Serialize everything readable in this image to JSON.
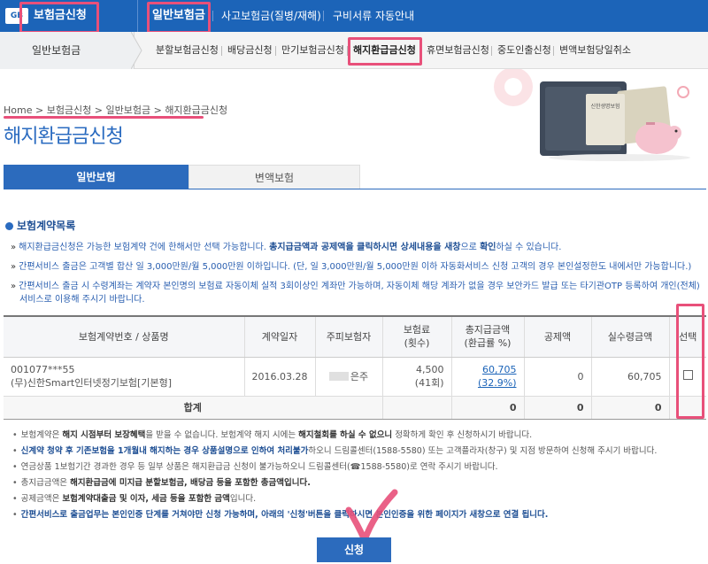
{
  "topbar": {
    "logo_icon": "insurance-logo-icon",
    "logo_text": "GB",
    "title": "보험금신청",
    "tabs": [
      {
        "label": "일반보험금",
        "active": true
      },
      {
        "label": "사고보험금(질병/재해)",
        "active": false
      },
      {
        "label": "구비서류 자동안내",
        "active": false
      }
    ],
    "highlight_color": "#e8507a",
    "brand_color": "#1c64b8"
  },
  "subnav": {
    "current": "일반보험금",
    "items": [
      {
        "label": "분할보험금신청",
        "active": false
      },
      {
        "label": "배당금신청",
        "active": false
      },
      {
        "label": "만기보험금신청",
        "active": false
      },
      {
        "label": "해지환급금신청",
        "active": true
      },
      {
        "label": "휴면보험금신청",
        "active": false
      },
      {
        "label": "중도인출신청",
        "active": false
      },
      {
        "label": "변액보험당일취소",
        "active": false
      }
    ]
  },
  "breadcrumb": "Home > 보험금신청 > 일반보험금 > 해지환급금신청",
  "page_title": "해지환급금신청",
  "illustration": {
    "wallet_label": "신한생명보험"
  },
  "tabs": [
    {
      "label": "일반보험",
      "active": true
    },
    {
      "label": "변액보험",
      "active": false
    }
  ],
  "section": {
    "title": "보험계약목록",
    "notices": [
      {
        "plain": "해지환급금신청은 가능한 보험계약 건에 한해서만 선택 가능합니다. ",
        "bold": "총지급금액과 공제액을 클릭하시면 상세내용을 새창",
        "plain2": "으로 ",
        "bold2": "확인",
        "plain3": "하실 수 있습니다."
      },
      {
        "plain": "간편서비스 출금은 고객별 합산 일 3,000만원/월 5,000만원 이하입니다. (단, 일 3,000만원/월 5,000만원 이하 자동화서비스 신청 고객의 경우 본인설정한도 내에서만 가능합니다.)",
        "bold": "",
        "plain2": "",
        "bold2": "",
        "plain3": ""
      },
      {
        "plain": "간편서비스 출금 시 수령계좌는 계약자 본인명의 보험료 자동이체 실적 3회이상인 계좌만 가능하며, 자동이체 해당 계좌가 없을 경우 보안카드 발급 또는 타기관OTP 등록하여 개인(전체)",
        "bold": "",
        "plain2": "",
        "bold2": "",
        "plain3": ""
      },
      {
        "plain": "서비스로 이용해 주시기 바랍니다.",
        "bold": "",
        "plain2": "",
        "bold2": "",
        "plain3": ""
      }
    ]
  },
  "table": {
    "headers": [
      "보험계약번호 / 상품명",
      "계약일자",
      "주피보험자",
      "보험료\n(횟수)",
      "총지급금액\n(환급률 %)",
      "공제액",
      "실수령금액",
      "선택"
    ],
    "rows": [
      {
        "contract_no": "001077***55",
        "product": "(무)신한Smart인터넷정기보험[기본형]",
        "date": "2016.03.28",
        "insured": "은주",
        "premium": "4,500",
        "count": "(41회)",
        "total": "60,705",
        "rate": "(32.9%)",
        "deduction": "0",
        "net": "60,705"
      }
    ],
    "sum": {
      "label": "합계",
      "total": "0",
      "deduction": "0",
      "net": "0"
    }
  },
  "notes": [
    {
      "a": "보험계약은 ",
      "b": "해지 시점부터 보장혜택",
      "c": "을 받을 수 없습니다. 보험계약 해지 시에는 ",
      "d": "해지철회를 하실 수 없으니",
      "e": " 정확하게 확인 후 신청하시기 바랍니다."
    },
    {
      "a": "",
      "b": "신계약 청약 후 기존보험을 1개월내 해지하는 경우 상품설명으로 인하여 처리불가",
      "c": "하오니 드림콜센터(1588-5580) 또는 고객플라자(창구) 및 지점 방문하여 신청해 주시기 바랍니다.",
      "d": "",
      "e": ""
    },
    {
      "a": "연금상품 1보험기간 경과한 경우 등 일부 상품은 해지환급금 신청이 불가능하오니 드림콜센터(☎1588-5580)로 연락 주시기 바랍니다.",
      "b": "",
      "c": "",
      "d": "",
      "e": ""
    },
    {
      "a": "총지급금액은 ",
      "b": "해지환급금에 미지급 분할보험금, 배당금 등을 포함한 총금액입니다.",
      "c": "",
      "d": "",
      "e": ""
    },
    {
      "a": "공제금액은 ",
      "b": "보험계약대출금 및 이자, 세금 등을 포함한 금액",
      "c": "입니다.",
      "d": "",
      "e": ""
    },
    {
      "a": "",
      "b": "간편서비스로 출금업무는 본인인증 단계를 거쳐야만 신청 가능하며, 아래의 '신청'버튼을 클릭하시면 본인인증을 위한 페이지가 새창으로 연결 됩니다.",
      "c": "",
      "d": "",
      "e": ""
    }
  ],
  "apply_button": "신청"
}
